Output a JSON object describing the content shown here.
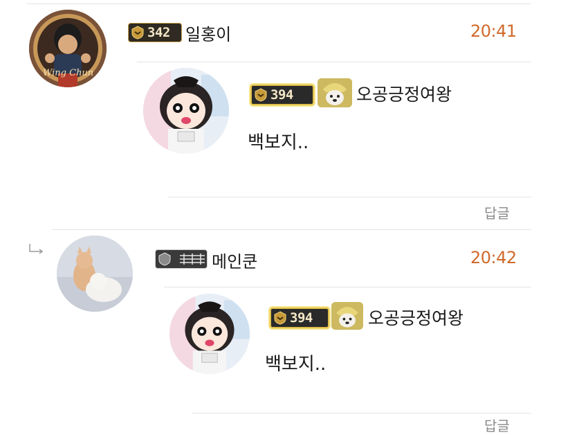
{
  "colors": {
    "time": "#d0692a",
    "reply": "#8a8a8a",
    "divider": "#e4e4e4",
    "badge_gold": "#d9b04a"
  },
  "comments": [
    {
      "badge_level": "342",
      "nickname": "일홍이",
      "time": "20:41",
      "avatar_caption": "Wing Chun",
      "quoted": {
        "badge_level": "394",
        "nickname": "오공긍정여왕",
        "message": "백보지..",
        "reply_label": "답글"
      }
    },
    {
      "badge_level": "",
      "nickname": "메인쿤",
      "time": "20:42",
      "quoted": {
        "badge_level": "394",
        "nickname": "오공긍정여왕",
        "message": "백보지..",
        "reply_label": "답글"
      }
    }
  ],
  "icons": {
    "reply_arrow": "reply-arrow-icon",
    "level_emblem": "shield-emblem-icon"
  }
}
